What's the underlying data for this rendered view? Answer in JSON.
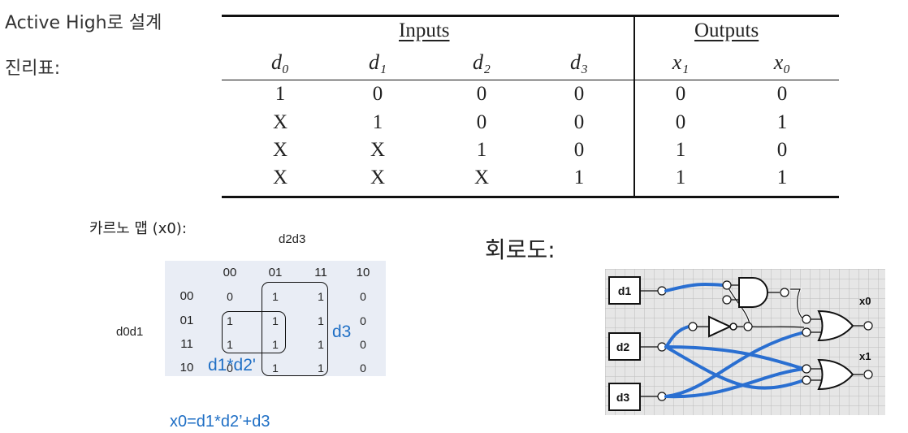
{
  "heading": {
    "design": "Active High로 설계",
    "truth_table_label": "진리표:"
  },
  "truth_table": {
    "group_inputs": "Inputs",
    "group_outputs": "Outputs",
    "columns": [
      "d₀",
      "d₁",
      "d₂",
      "d₃",
      "x₁",
      "x₀"
    ],
    "rows": [
      [
        "1",
        "0",
        "0",
        "0",
        "0",
        "0"
      ],
      [
        "X",
        "1",
        "0",
        "0",
        "0",
        "1"
      ],
      [
        "X",
        "X",
        "1",
        "0",
        "1",
        "0"
      ],
      [
        "X",
        "X",
        "X",
        "1",
        "1",
        "1"
      ]
    ]
  },
  "kmap": {
    "title": "카르노 맵 (x0):",
    "col_var": "d2d3",
    "row_var": "d0d1",
    "col_headers": [
      "00",
      "01",
      "11",
      "10"
    ],
    "row_headers": [
      "00",
      "01",
      "11",
      "10"
    ],
    "cells": [
      [
        "0",
        "1",
        "1",
        "0"
      ],
      [
        "1",
        "1",
        "1",
        "0"
      ],
      [
        "1",
        "1",
        "1",
        "0"
      ],
      [
        "0",
        "1",
        "1",
        "0"
      ]
    ],
    "loop_label_d3": "d3",
    "loop_label_d1d2": "d1*d2'",
    "formula": "x0=d1*d2’+d3"
  },
  "circuit": {
    "title": "회로도:",
    "inputs": [
      "d1",
      "d2",
      "d3"
    ],
    "outputs": [
      "x0",
      "x1"
    ],
    "colors": {
      "wire": "#2a6fd1",
      "background": "#e6e6e6",
      "grid": "#bcbcbc"
    }
  }
}
